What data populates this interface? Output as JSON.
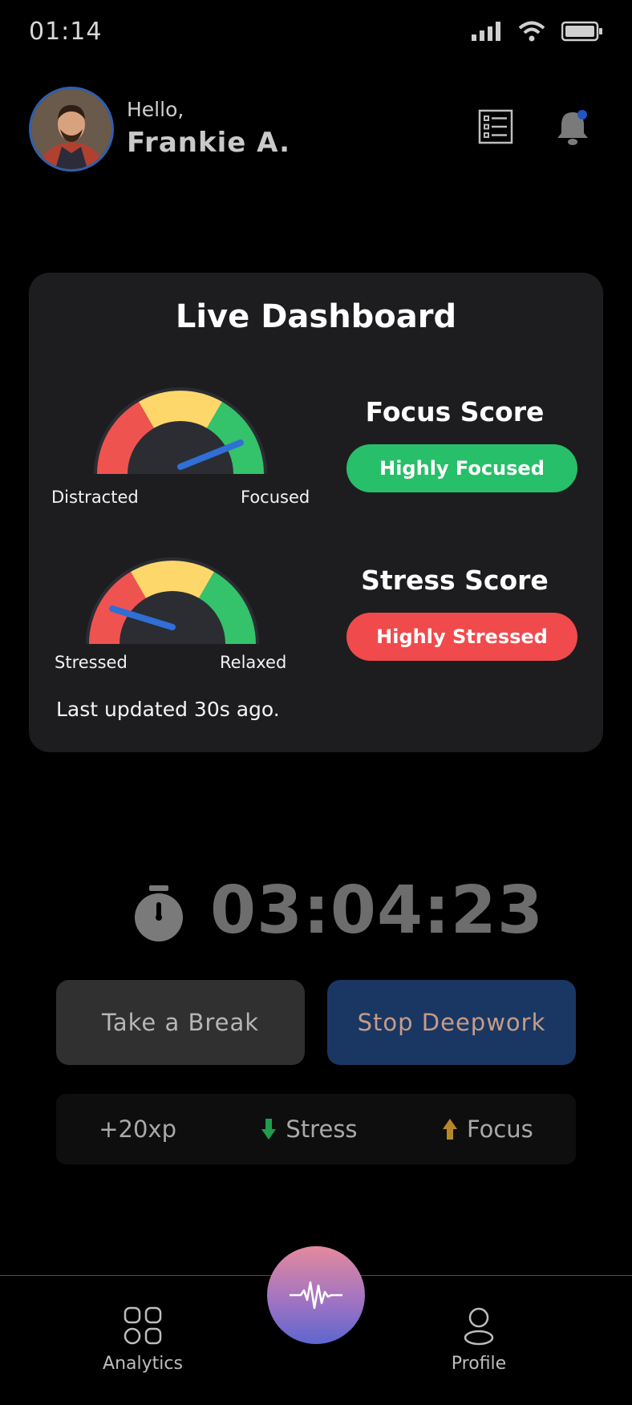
{
  "status_bar": {
    "time": "01:14"
  },
  "header": {
    "greeting": "Hello,",
    "name": "Frankie A."
  },
  "dashboard": {
    "title": "Live Dashboard",
    "focus": {
      "left_label": "Distracted",
      "right_label": "Focused",
      "title": "Focus Score",
      "badge": "Highly Focused",
      "badge_color": "#27bf69"
    },
    "stress": {
      "left_label": "Stressed",
      "right_label": "Relaxed",
      "title": "Stress Score",
      "badge": "Highly Stressed",
      "badge_color": "#f04a4d"
    },
    "last_updated": "Last updated 30s ago."
  },
  "timer": {
    "value": "03:04:23"
  },
  "actions": {
    "break_label": "Take a Break",
    "stop_label": "Stop Deepwork"
  },
  "rewards": {
    "xp": "+20xp",
    "stress_label": "Stress",
    "focus_label": "Focus"
  },
  "nav": {
    "analytics_label": "Analytics",
    "profile_label": "Profile"
  },
  "colors": {
    "gauge_red": "#ef5350",
    "gauge_yellow": "#fdd76a",
    "gauge_green": "#34c26b",
    "needle": "#2f6fd6",
    "accent_blue": "#1a3763"
  }
}
